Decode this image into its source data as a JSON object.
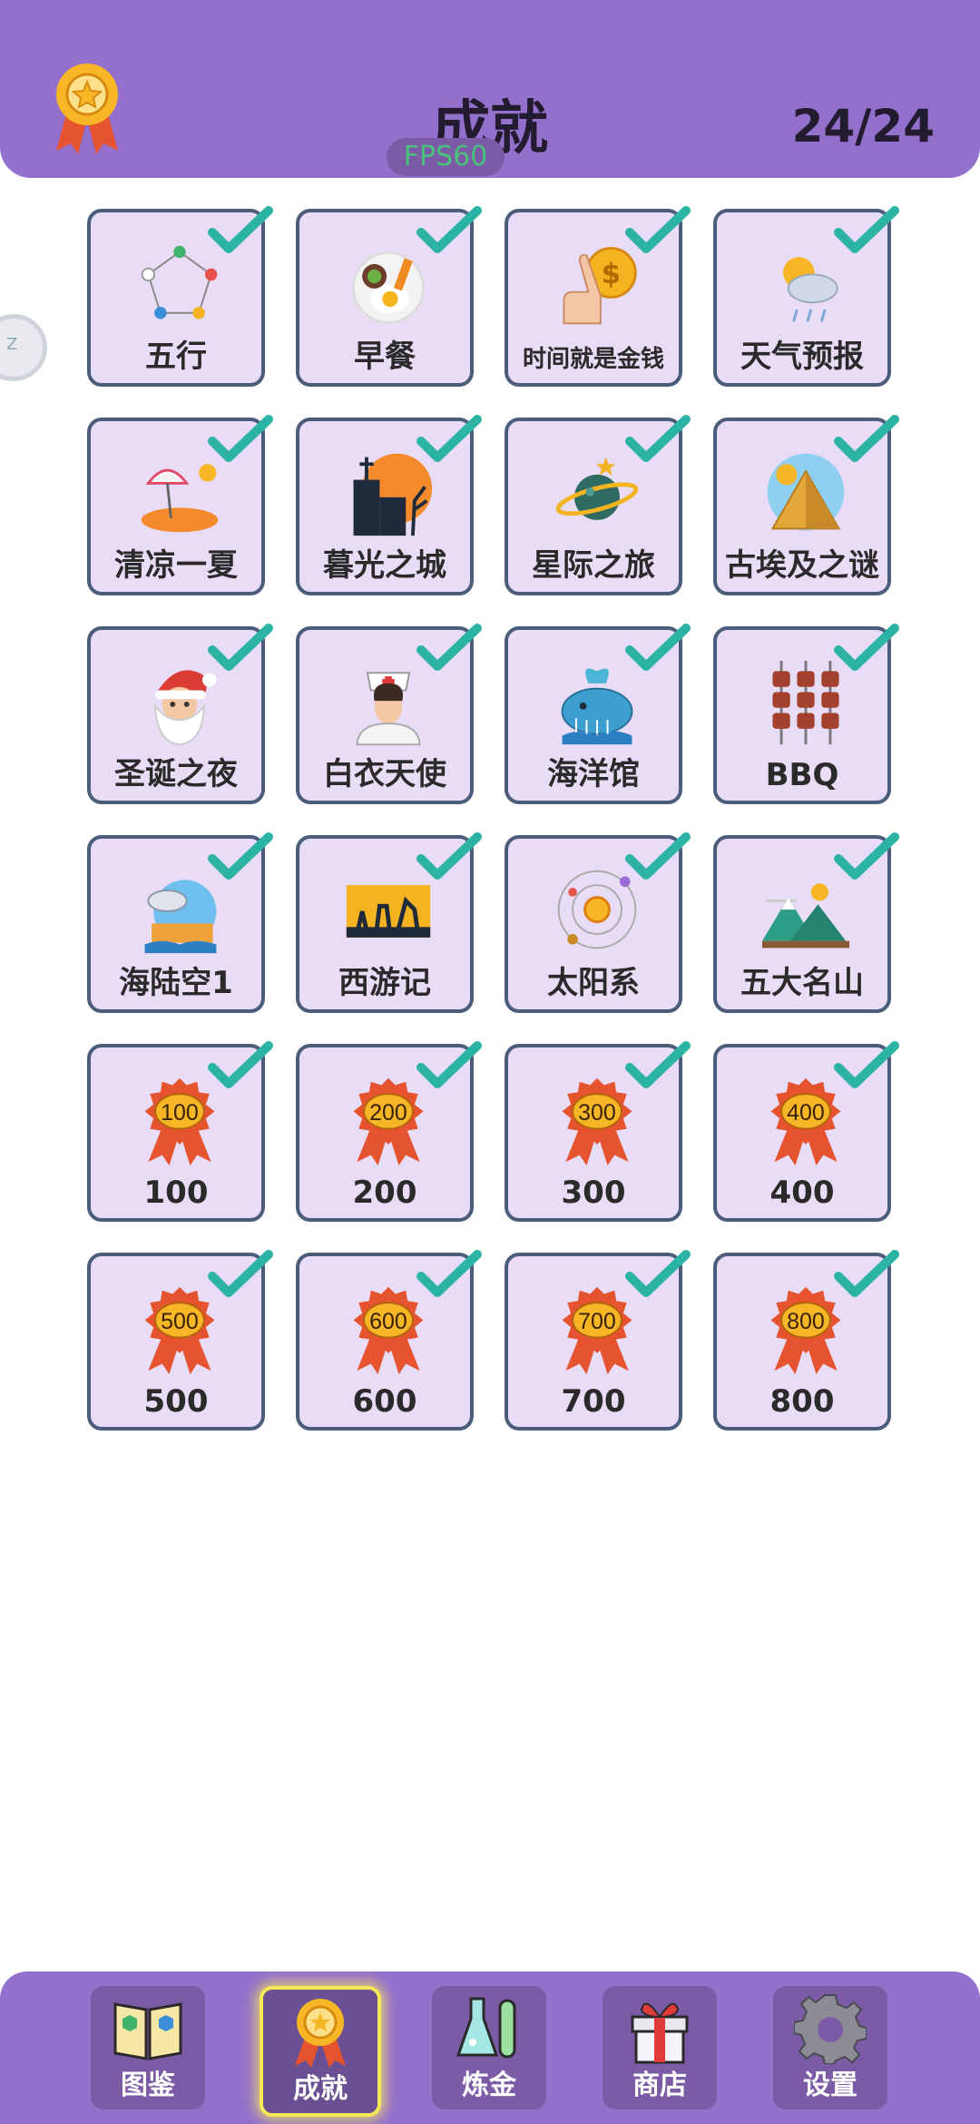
{
  "header": {
    "title": "成就",
    "progress": "24/24",
    "fps": "FPS60"
  },
  "side_handle_text": "Z",
  "achievements": [
    {
      "label": "五行",
      "icon": "five-elements-icon"
    },
    {
      "label": "早餐",
      "icon": "breakfast-icon"
    },
    {
      "label": "时间就是金钱",
      "icon": "money-hand-icon"
    },
    {
      "label": "天气预报",
      "icon": "weather-icon"
    },
    {
      "label": "清凉一夏",
      "icon": "beach-icon"
    },
    {
      "label": "暮光之城",
      "icon": "twilight-castle-icon"
    },
    {
      "label": "星际之旅",
      "icon": "planet-icon"
    },
    {
      "label": "古埃及之谜",
      "icon": "pyramid-icon"
    },
    {
      "label": "圣诞之夜",
      "icon": "santa-icon"
    },
    {
      "label": "白衣天使",
      "icon": "nurse-icon"
    },
    {
      "label": "海洋馆",
      "icon": "whale-icon"
    },
    {
      "label": "BBQ",
      "icon": "skewer-icon"
    },
    {
      "label": "海陆空1",
      "icon": "sea-land-sky-icon"
    },
    {
      "label": "西游记",
      "icon": "journey-west-icon"
    },
    {
      "label": "太阳系",
      "icon": "solar-system-icon"
    },
    {
      "label": "五大名山",
      "icon": "mountains-icon"
    },
    {
      "label": "100",
      "medal": "100",
      "icon": "medal-icon"
    },
    {
      "label": "200",
      "medal": "200",
      "icon": "medal-icon"
    },
    {
      "label": "300",
      "medal": "300",
      "icon": "medal-icon"
    },
    {
      "label": "400",
      "medal": "400",
      "icon": "medal-icon"
    },
    {
      "label": "500",
      "medal": "500",
      "icon": "medal-icon"
    },
    {
      "label": "600",
      "medal": "600",
      "icon": "medal-icon"
    },
    {
      "label": "700",
      "medal": "700",
      "icon": "medal-icon"
    },
    {
      "label": "800",
      "medal": "800",
      "icon": "medal-icon"
    }
  ],
  "nav": [
    {
      "label": "图鉴",
      "icon": "book-icon",
      "active": false
    },
    {
      "label": "成就",
      "icon": "medal-icon",
      "active": true
    },
    {
      "label": "炼金",
      "icon": "flask-icon",
      "active": false
    },
    {
      "label": "商店",
      "icon": "gift-icon",
      "active": false
    },
    {
      "label": "设置",
      "icon": "gear-icon",
      "active": false
    }
  ],
  "colors": {
    "header_bg": "#9370cc",
    "card_bg": "#e8dcf7",
    "card_border": "#4c5d7b",
    "check": "#2bb3a3",
    "nav_active_glow": "#f5e95a"
  }
}
